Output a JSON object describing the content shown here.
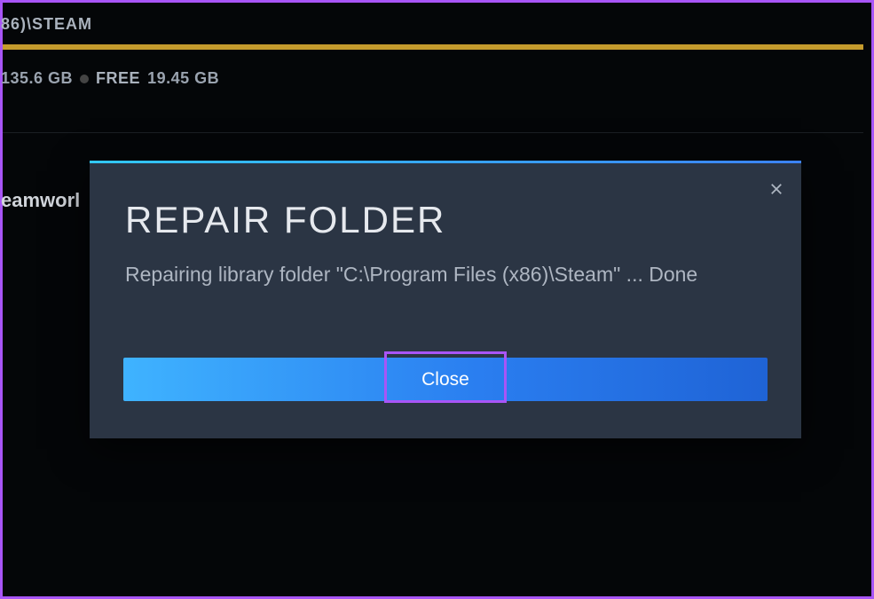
{
  "background": {
    "path_fragment": "86)\\STEAM",
    "storage": {
      "used_value": "135.6 GB",
      "free_label": "FREE",
      "free_value": "19.45 GB"
    },
    "side_label": "eamworl"
  },
  "dialog": {
    "title": "REPAIR FOLDER",
    "body": "Repairing library folder \"C:\\Program Files (x86)\\Steam\" ... Done",
    "close_button_label": "Close"
  }
}
